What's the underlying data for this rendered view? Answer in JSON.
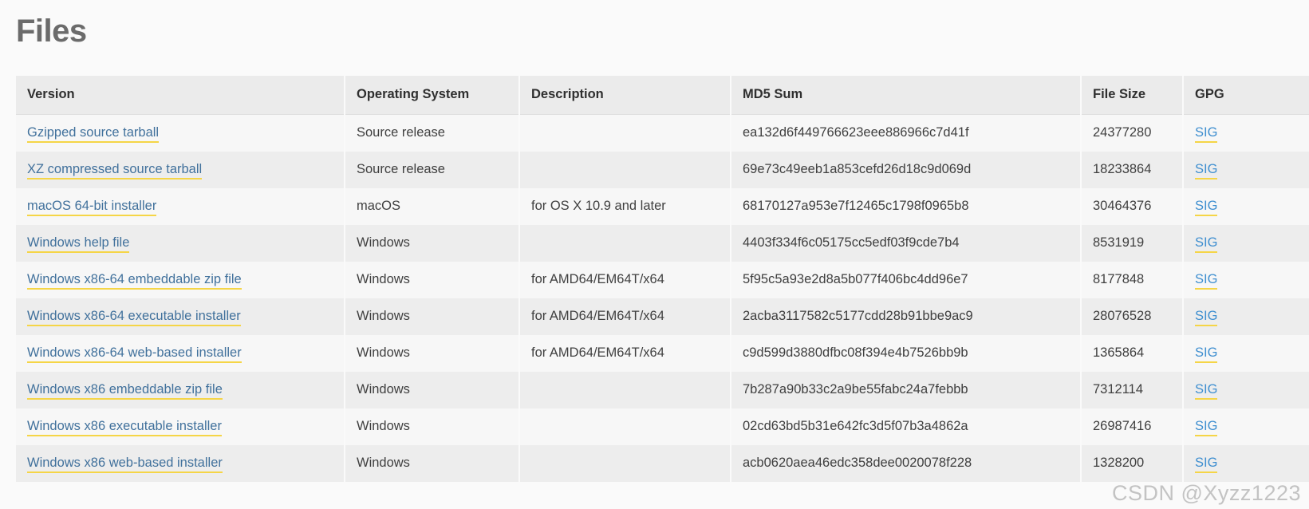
{
  "page": {
    "title": "Files"
  },
  "table": {
    "columns": [
      {
        "key": "version",
        "label": "Version"
      },
      {
        "key": "os",
        "label": "Operating System"
      },
      {
        "key": "description",
        "label": "Description"
      },
      {
        "key": "md5",
        "label": "MD5 Sum"
      },
      {
        "key": "size",
        "label": "File Size"
      },
      {
        "key": "gpg",
        "label": "GPG"
      }
    ],
    "rows": [
      {
        "version": "Gzipped source tarball",
        "os": "Source release",
        "description": "",
        "md5": "ea132d6f449766623eee886966c7d41f",
        "size": "24377280",
        "gpg": "SIG"
      },
      {
        "version": "XZ compressed source tarball",
        "os": "Source release",
        "description": "",
        "md5": "69e73c49eeb1a853cefd26d18c9d069d",
        "size": "18233864",
        "gpg": "SIG"
      },
      {
        "version": "macOS 64-bit installer",
        "os": "macOS",
        "description": "for OS X 10.9 and later",
        "md5": "68170127a953e7f12465c1798f0965b8",
        "size": "30464376",
        "gpg": "SIG"
      },
      {
        "version": "Windows help file",
        "os": "Windows",
        "description": "",
        "md5": "4403f334f6c05175cc5edf03f9cde7b4",
        "size": "8531919",
        "gpg": "SIG"
      },
      {
        "version": "Windows x86-64 embeddable zip file",
        "os": "Windows",
        "description": "for AMD64/EM64T/x64",
        "md5": "5f95c5a93e2d8a5b077f406bc4dd96e7",
        "size": "8177848",
        "gpg": "SIG"
      },
      {
        "version": "Windows x86-64 executable installer",
        "os": "Windows",
        "description": "for AMD64/EM64T/x64",
        "md5": "2acba3117582c5177cdd28b91bbe9ac9",
        "size": "28076528",
        "gpg": "SIG"
      },
      {
        "version": "Windows x86-64 web-based installer",
        "os": "Windows",
        "description": "for AMD64/EM64T/x64",
        "md5": "c9d599d3880dfbc08f394e4b7526bb9b",
        "size": "1365864",
        "gpg": "SIG"
      },
      {
        "version": "Windows x86 embeddable zip file",
        "os": "Windows",
        "description": "",
        "md5": "7b287a90b33c2a9be55fabc24a7febbb",
        "size": "7312114",
        "gpg": "SIG"
      },
      {
        "version": "Windows x86 executable installer",
        "os": "Windows",
        "description": "",
        "md5": "02cd63bd5b31e642fc3d5f07b3a4862a",
        "size": "26987416",
        "gpg": "SIG"
      },
      {
        "version": "Windows x86 web-based installer",
        "os": "Windows",
        "description": "",
        "md5": "acb0620aea46edc358dee0020078f228",
        "size": "1328200",
        "gpg": "SIG"
      }
    ]
  },
  "watermark": {
    "text": "CSDN @Xyzz1223"
  },
  "colors": {
    "link": "#41719c",
    "link_underline": "#f5d547",
    "sig_link": "#3f8fd0",
    "header_bg": "#ebebeb",
    "row_odd_bg": "#f7f7f7",
    "row_even_bg": "#ededed",
    "page_bg": "#fafafa",
    "title": "#6b6b6b"
  }
}
